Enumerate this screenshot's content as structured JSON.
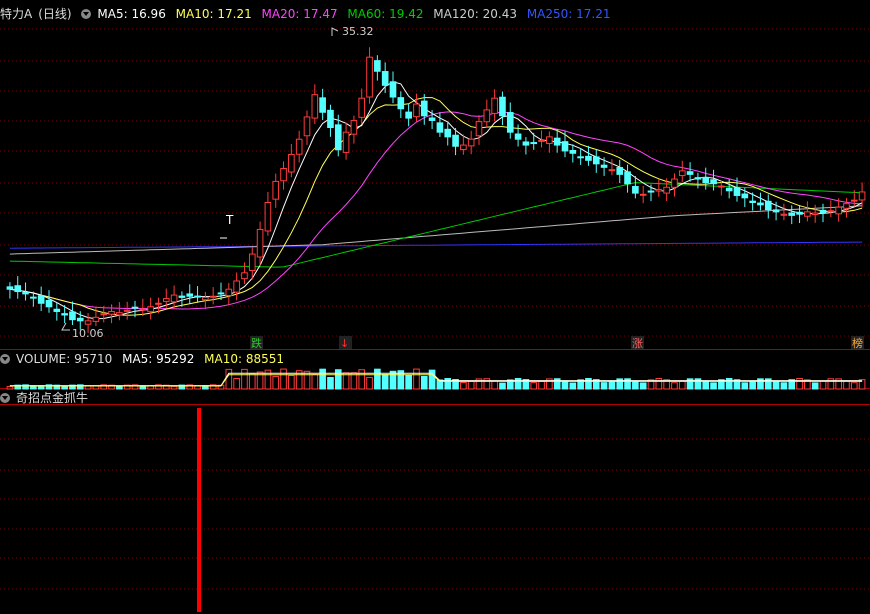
{
  "main_header": {
    "stock_name": "特力A",
    "period": "(日线)",
    "ma5": "MA5: 16.96",
    "ma10": "MA10: 17.21",
    "ma20": "MA20: 17.47",
    "ma60": "MA60: 19.42",
    "ma120": "MA120: 20.43",
    "ma250": "MA250: 17.21"
  },
  "volume_header": {
    "label": "VOLUME: 95710",
    "ma5": "MA5: 95292",
    "ma10": "MA10: 88551"
  },
  "indicator_header": {
    "label": "奇招点金抓牛"
  },
  "annotations": {
    "high_label": "35.32",
    "low_label": "10.06",
    "marker_t": "T",
    "event_markers": [
      "跌",
      "↓",
      "涨",
      "榜"
    ]
  },
  "colors": {
    "up": "#ff3b3b",
    "down": "#54ffff",
    "ma5": "#ffffff",
    "ma10": "#ffff55",
    "ma20": "#ff44ff",
    "ma60": "#00cc00",
    "ma120": "#bbbbbb",
    "ma250": "#3333ff",
    "signal": "#ff0000"
  },
  "chart_data": {
    "type": "candlestick",
    "price_high": 35.32,
    "price_low": 10.06,
    "ma_values_last": {
      "MA5": 16.96,
      "MA10": 17.21,
      "MA20": 17.47,
      "MA60": 19.42,
      "MA120": 20.43,
      "MA250": 17.21
    },
    "volume_last": 95710,
    "volume_ma5": 95292,
    "volume_ma10": 88551
  }
}
